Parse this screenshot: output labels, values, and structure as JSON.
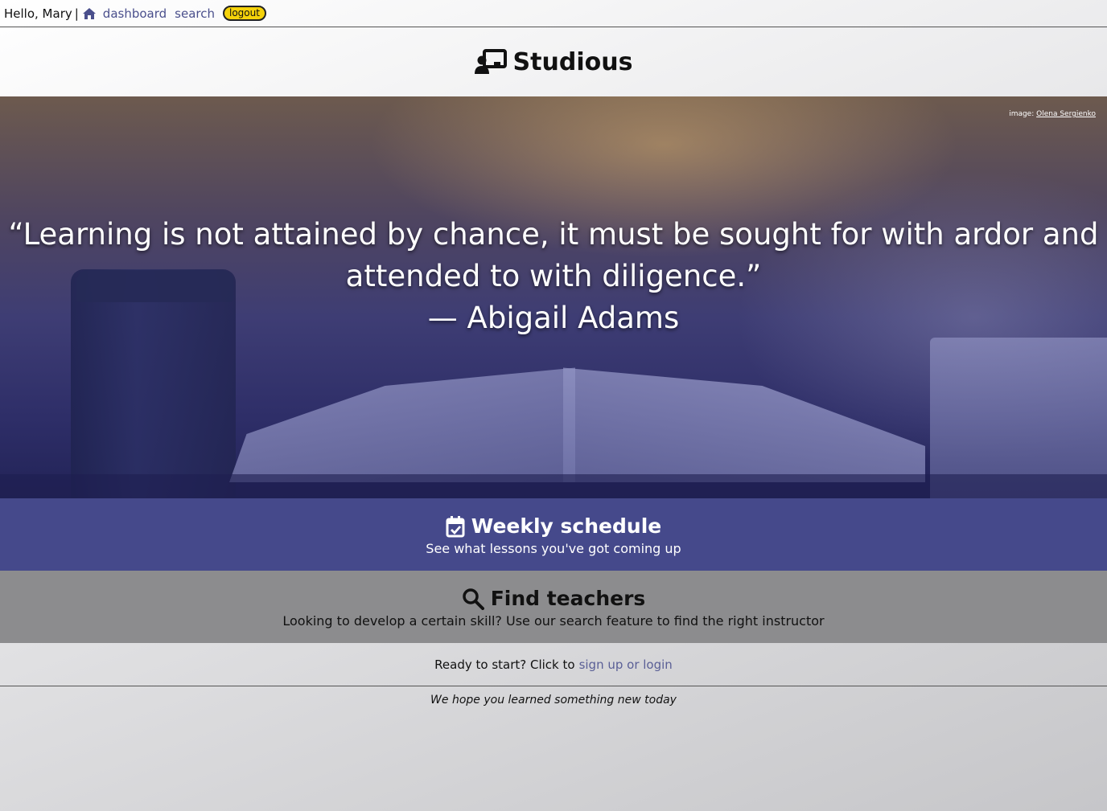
{
  "nav": {
    "greeting": "Hello, Mary",
    "separator": "|",
    "links": {
      "dashboard": "dashboard",
      "search": "search",
      "logout": "logout"
    },
    "home_icon": "home-icon"
  },
  "brand": {
    "title": "Studious",
    "icon": "teacher-board-icon"
  },
  "hero": {
    "credit_prefix": "image:",
    "credit_name": "Olena Sergienko",
    "quote_line1": "“Learning is not attained by chance, it must be sought for with ardor and",
    "quote_line2": "attended to with diligence.”",
    "author": "— Abigail Adams"
  },
  "schedule": {
    "title": "Weekly schedule",
    "subtitle": "See what lessons you've got coming up",
    "icon": "calendar-check-icon"
  },
  "find": {
    "title": "Find teachers",
    "subtitle": "Looking to develop a certain skill? Use our search feature to find the right instructor",
    "icon": "search-icon"
  },
  "footer": {
    "ready_text": "Ready to start? Click to",
    "signup_link": "sign up or login",
    "tagline": "We hope you learned something new today"
  },
  "colors": {
    "accent_link": "#4a4f8c",
    "logout_bg": "#f5d20a",
    "schedule_band": "#45498b",
    "find_band": "#8c8c8e"
  }
}
